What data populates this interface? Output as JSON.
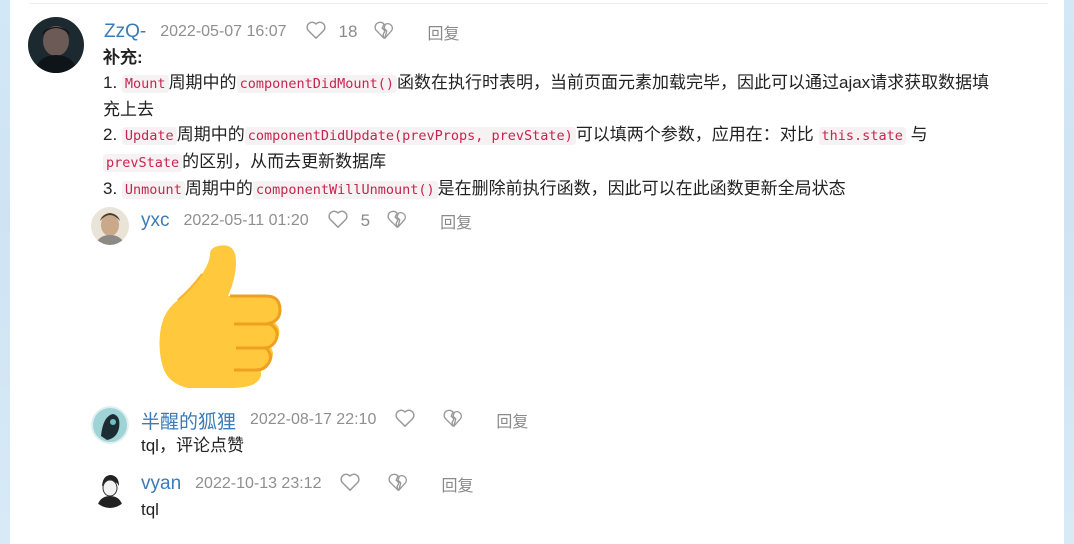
{
  "comments": [
    {
      "user": "ZzQ-",
      "time": "2022-05-07 16:07",
      "likes": "18",
      "reply": "回复",
      "label": "补充:",
      "lines": [
        {
          "num": "1.",
          "code1": "Mount",
          "t1": "周期中的",
          "code2": "componentDidMount()",
          "t2": "函数在执行时表明，当前页面元素加载完毕，因此可以通过ajax请求获取数据填"
        },
        {
          "cont": "充上去"
        },
        {
          "num": "2.",
          "code1": "Update",
          "t1": "周期中的",
          "code2": "componentDidUpdate(prevProps, prevState)",
          "t2": "可以填两个参数，应用在：对比",
          "code3": "this.state",
          "t3": "与"
        },
        {
          "code1": "prevState",
          "t1": "的区别，从而去更新数据库"
        },
        {
          "num": "3.",
          "code1": "Unmount",
          "t1": "周期中的",
          "code2": "componentWillUnmount()",
          "t2": "是在删除前执行函数，因此可以在此函数更新全局状态"
        }
      ]
    },
    {
      "user": "yxc",
      "time": "2022-05-11 01:20",
      "likes": "5",
      "reply": "回复",
      "emoji": "👍"
    },
    {
      "user": "半醒的狐狸",
      "time": "2022-08-17 22:10",
      "reply": "回复",
      "text": "tql，评论点赞"
    },
    {
      "user": "vyan",
      "time": "2022-10-13 23:12",
      "reply": "回复",
      "text": "tql"
    }
  ]
}
